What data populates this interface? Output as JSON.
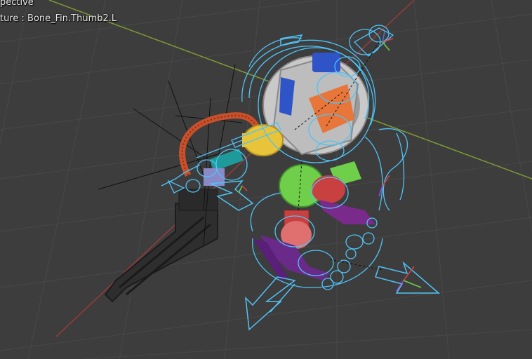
{
  "viewport": {
    "view_mode": "pective",
    "active_object": "ture : Bone_Fin.Thumb2.L"
  },
  "colors": {
    "background": "#3d3d3d",
    "grid": "#484848",
    "x_axis": "#9a3a3a",
    "y_axis": "#7f9a32",
    "bone_outline": "#4fc3f7",
    "mesh_body": "#c9c9c9",
    "accent_orange": "#e8753a",
    "accent_yellow": "#e8c43a",
    "accent_green": "#6fcf4a",
    "accent_blue": "#2f54c8",
    "accent_purple": "#6a2a8a",
    "accent_red": "#c84040",
    "hose": "#c8502a"
  },
  "icons": [
    "gizmo-arrow-icon"
  ]
}
